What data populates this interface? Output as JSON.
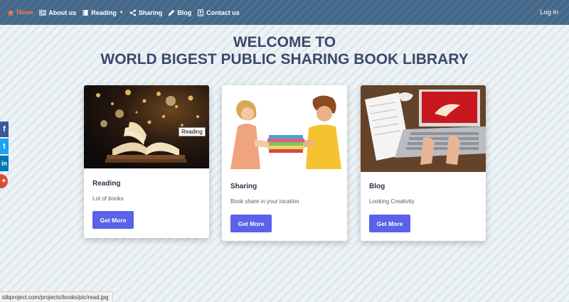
{
  "nav": {
    "items": [
      {
        "label": "Home",
        "icon": "home-icon"
      },
      {
        "label": "About us",
        "icon": "id-card-icon"
      },
      {
        "label": "Reading",
        "icon": "book-icon"
      },
      {
        "label": "Sharing",
        "icon": "share-icon"
      },
      {
        "label": "Blog",
        "icon": "pencil-icon"
      },
      {
        "label": "Contact us",
        "icon": "contact-icon"
      }
    ],
    "login": "Log in"
  },
  "hero": {
    "line1": "WELCOME TO",
    "line2": "WORLD BIGEST PUBLIC SHARING BOOK LIBRARY"
  },
  "cards": [
    {
      "title": "Reading",
      "text": "Lot of books",
      "button": "Get More",
      "tooltip": "Reading"
    },
    {
      "title": "Sharing",
      "text": "Book share in your location",
      "button": "Get More"
    },
    {
      "title": "Blog",
      "text": "Looking Creativity",
      "button": "Get More"
    }
  ],
  "social": [
    {
      "name": "facebook",
      "glyph": "f",
      "color": "#3b5998"
    },
    {
      "name": "twitter",
      "glyph": "t",
      "color": "#1da1f2"
    },
    {
      "name": "linkedin",
      "glyph": "in",
      "color": "#0077b5"
    },
    {
      "name": "google-plus",
      "glyph": "+",
      "color": "#dd4b39"
    }
  ],
  "status_bar": "idbproject.com/projects/books/pic/read.jpg",
  "colors": {
    "nav": "#446789",
    "active": "#ee7a5b",
    "button": "#5962e9",
    "heading": "#3a4a6b"
  }
}
